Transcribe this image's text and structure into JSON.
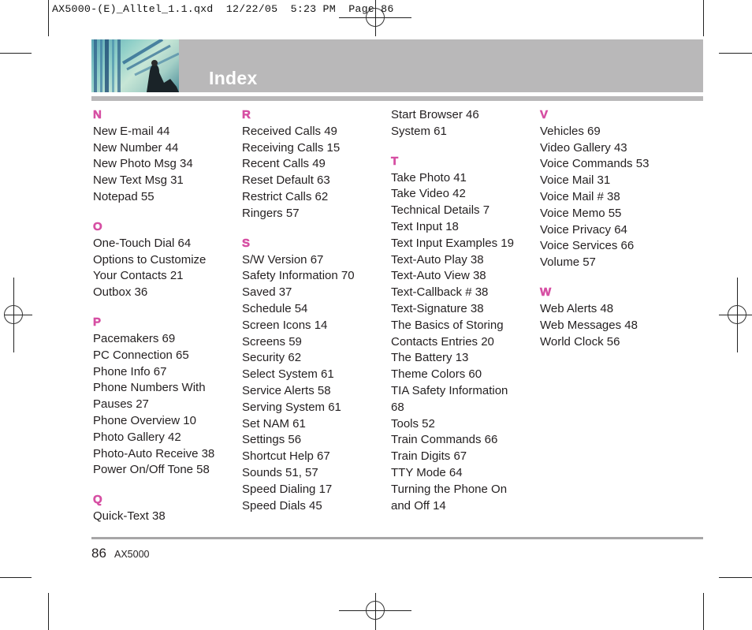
{
  "print_slug": "AX5000-(E)_Alltel_1.1.qxd  12/22/05  5:23 PM  Page 86",
  "header": {
    "title": "Index",
    "photo": "office-building-businessman-photo"
  },
  "columns": [
    {
      "sections": [
        {
          "letter": "N",
          "entries": [
            "New E-mail 44",
            "New Number 44",
            "New Photo Msg 34",
            "New Text Msg 31",
            "Notepad 55"
          ]
        },
        {
          "letter": "O",
          "entries": [
            "One-Touch Dial 64",
            "Options to Customize",
            "Your Contacts 21",
            "Outbox 36"
          ]
        },
        {
          "letter": "P",
          "entries": [
            "Pacemakers 69",
            "PC Connection 65",
            "Phone Info 67",
            "Phone Numbers With",
            "Pauses 27",
            "Phone Overview 10",
            "Photo Gallery 42",
            "Photo-Auto Receive 38",
            "Power On/Off Tone 58"
          ]
        },
        {
          "letter": "Q",
          "entries": [
            "Quick-Text 38"
          ]
        }
      ]
    },
    {
      "sections": [
        {
          "letter": "R",
          "entries": [
            "Received Calls 49",
            "Receiving Calls 15",
            "Recent Calls 49",
            "Reset Default 63",
            "Restrict Calls 62",
            "Ringers 57"
          ]
        },
        {
          "letter": "S",
          "entries": [
            "S/W Version 67",
            "Safety Information 70",
            "Saved 37",
            "Schedule 54",
            "Screen Icons 14",
            "Screens 59",
            "Security 62",
            "Select System 61",
            "Service Alerts 58",
            "Serving System 61",
            "Set NAM 61",
            "Settings 56",
            "Shortcut Help 67",
            "Sounds 51, 57",
            "Speed Dialing 17",
            "Speed Dials 45"
          ]
        }
      ]
    },
    {
      "sections": [
        {
          "letter": "",
          "entries": [
            "Start Browser 46",
            "System 61"
          ]
        },
        {
          "letter": "T",
          "entries": [
            "Take Photo 41",
            "Take Video 42",
            "Technical Details 7",
            "Text Input 18",
            "Text Input Examples 19",
            "Text-Auto Play 38",
            "Text-Auto View 38",
            "Text-Callback # 38",
            "Text-Signature 38",
            "The Basics of Storing",
            "Contacts Entries 20",
            "The Battery 13",
            "Theme Colors 60",
            "TIA Safety Information",
            "68",
            "Tools 52",
            "Train Commands 66",
            "Train Digits 67",
            "TTY Mode 64",
            "Turning the Phone On",
            "and Off 14"
          ]
        }
      ]
    },
    {
      "sections": [
        {
          "letter": "V",
          "entries": [
            "Vehicles 69",
            "Video Gallery 43",
            "Voice Commands 53",
            "Voice Mail 31",
            "Voice Mail # 38",
            "Voice Memo 55",
            "Voice Privacy 64",
            "Voice Services 66",
            "Volume 57"
          ]
        },
        {
          "letter": "W",
          "entries": [
            "Web Alerts 48",
            "Web Messages 48",
            "World Clock 56"
          ]
        }
      ]
    }
  ],
  "footer": {
    "page_number": "86",
    "model": "AX5000"
  },
  "colors": {
    "letter_accent": "#d64fa3",
    "header_band": "#b9b8b9",
    "title_text": "#ffffff",
    "body_text": "#231f20"
  }
}
